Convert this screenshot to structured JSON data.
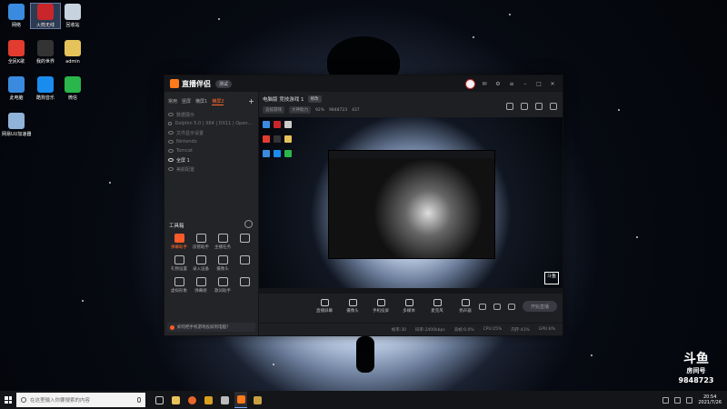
{
  "desktop": {
    "icons": [
      {
        "label": "网络",
        "icon": "network-icon",
        "color": "#3a8be0"
      },
      {
        "label": "火箭无线",
        "icon": "app-red-icon",
        "color": "#c9262c"
      },
      {
        "label": "回收站",
        "icon": "recycle-bin-icon",
        "color": "#c8d3e0"
      },
      {
        "label": "全民K歌",
        "icon": "karaoke-icon",
        "color": "#e23b2f"
      },
      {
        "label": "我的世界",
        "icon": "app-dark-icon",
        "color": "#333"
      },
      {
        "label": "admin",
        "icon": "folder-icon",
        "color": "#e6c25a"
      },
      {
        "label": "此电脑",
        "icon": "computer-icon",
        "color": "#3a8be0"
      },
      {
        "label": "酷狗音乐",
        "icon": "kugou-icon",
        "color": "#1a8cf0"
      },
      {
        "label": "微信",
        "icon": "wechat-icon",
        "color": "#2ab64a"
      },
      {
        "label": "网易UU加速器",
        "icon": "search-app-icon",
        "color": "#8fb3d9"
      }
    ]
  },
  "app": {
    "logo_text": "直播伴侣",
    "version_pill": "测试",
    "tabs": [
      "常用",
      "竖屏",
      "横屏1",
      "横屏2"
    ],
    "active_tab": 3,
    "scenes": [
      {
        "label": "数据展示",
        "active": false
      },
      {
        "label": "Dolphin 5.0 | X64 | DX11 | OpenGL | 1920x1080 | 30 FPS",
        "active": false
      },
      {
        "label": "文件显示设置",
        "active": false
      },
      {
        "label": "Nintendo",
        "active": false
      },
      {
        "label": "Tomcat",
        "active": false
      },
      {
        "label": "全屏 1",
        "active": true
      },
      {
        "label": "美颜配置",
        "active": false
      }
    ],
    "tools_title": "工具箱",
    "tools": [
      {
        "label": "弹幕助手",
        "hot": true
      },
      {
        "label": "房管助手",
        "hot": false
      },
      {
        "label": "主播任务",
        "hot": false
      },
      {
        "label": "",
        "hot": false
      },
      {
        "label": "礼物设置",
        "hot": false
      },
      {
        "label": "录入设备",
        "hot": false
      },
      {
        "label": "摄像头",
        "hot": false
      },
      {
        "label": "",
        "hot": false
      },
      {
        "label": "虚拟形象",
        "hot": false
      },
      {
        "label": "弹幕姬",
        "hot": false
      },
      {
        "label": "歌词助手",
        "hot": false
      },
      {
        "label": "",
        "hot": false
      }
    ],
    "tip_text": "如何把手机游戏投屏到电脑？",
    "room_title": "电脑版 竞技游戏 1",
    "edit_label": "修改",
    "meta": [
      "竞技游戏",
      "大神助力",
      "92%",
      "9848723",
      "437"
    ],
    "controls": [
      {
        "label": "直播屏幕"
      },
      {
        "label": "摄像头"
      },
      {
        "label": "手机投屏"
      },
      {
        "label": "多媒体"
      },
      {
        "label": "麦克风"
      },
      {
        "label": "扬声器"
      }
    ],
    "start_label": "开始直播",
    "status": [
      "帧率:30",
      "码率:2400kbps",
      "丢帧:0.0%",
      "CPU:25%",
      "内存:41%",
      "GPU:8%"
    ]
  },
  "watermark": {
    "logo": "斗鱼",
    "sub": "房间号",
    "number": "9848723"
  },
  "taskbar": {
    "search_placeholder": "在这里输入你要搜索的内容",
    "clock_time": "20:54",
    "clock_date": "2021/7/26"
  }
}
